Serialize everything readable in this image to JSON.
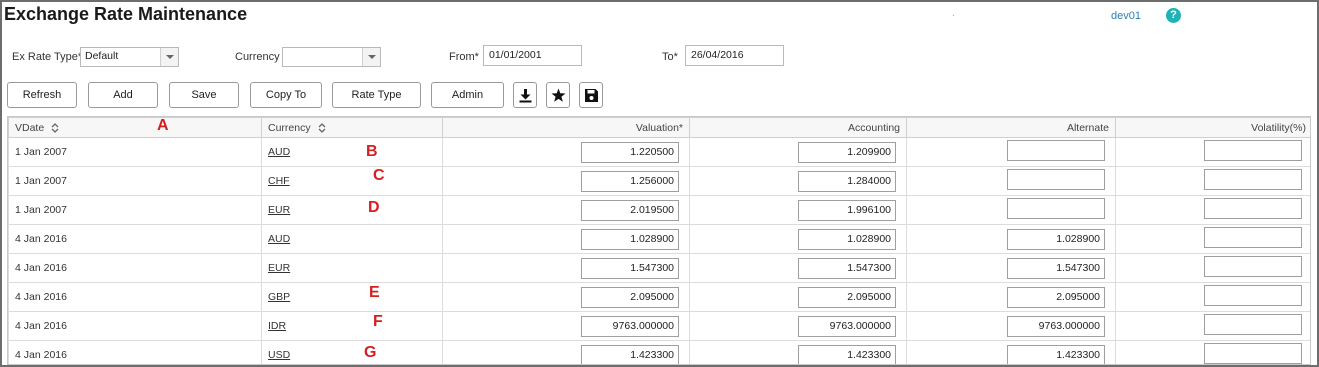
{
  "header": {
    "title": "Exchange Rate Maintenance",
    "separator": ".",
    "user": "dev01",
    "help_glyph": "?"
  },
  "filters": {
    "ex_rate_type_label": "Ex Rate Type*",
    "ex_rate_type_value": "Default",
    "currency_label": "Currency",
    "currency_value": "",
    "from_label": "From*",
    "from_value": "01/01/2001",
    "to_label": "To*",
    "to_value": "26/04/2016"
  },
  "toolbar": {
    "refresh": "Refresh",
    "add": "Add",
    "save": "Save",
    "copy_to": "Copy To",
    "rate_type": "Rate Type",
    "admin": "Admin",
    "icons": [
      "download-icon",
      "star-icon",
      "floppy-disk-icon"
    ]
  },
  "table": {
    "columns": [
      "VDate",
      "Currency",
      "Valuation*",
      "Accounting",
      "Alternate",
      "Volatility(%)"
    ],
    "rows": [
      {
        "vdate": "1 Jan 2007",
        "currency": "AUD",
        "valuation": "1.220500",
        "accounting": "1.209900",
        "alternate": "",
        "volatility": ""
      },
      {
        "vdate": "1 Jan 2007",
        "currency": "CHF",
        "valuation": "1.256000",
        "accounting": "1.284000",
        "alternate": "",
        "volatility": ""
      },
      {
        "vdate": "1 Jan 2007",
        "currency": "EUR",
        "valuation": "2.019500",
        "accounting": "1.996100",
        "alternate": "",
        "volatility": ""
      },
      {
        "vdate": "4 Jan 2016",
        "currency": "AUD",
        "valuation": "1.028900",
        "accounting": "1.028900",
        "alternate": "1.028900",
        "volatility": ""
      },
      {
        "vdate": "4 Jan 2016",
        "currency": "EUR",
        "valuation": "1.547300",
        "accounting": "1.547300",
        "alternate": "1.547300",
        "volatility": ""
      },
      {
        "vdate": "4 Jan 2016",
        "currency": "GBP",
        "valuation": "2.095000",
        "accounting": "2.095000",
        "alternate": "2.095000",
        "volatility": ""
      },
      {
        "vdate": "4 Jan 2016",
        "currency": "IDR",
        "valuation": "9763.000000",
        "accounting": "9763.000000",
        "alternate": "9763.000000",
        "volatility": ""
      },
      {
        "vdate": "4 Jan 2016",
        "currency": "USD",
        "valuation": "1.423300",
        "accounting": "1.423300",
        "alternate": "1.423300",
        "volatility": ""
      }
    ]
  },
  "markers": [
    "A",
    "B",
    "C",
    "D",
    "E",
    "F",
    "G"
  ],
  "colors": {
    "accent": "#2a7fb8",
    "help": "#1fb3b7",
    "marker": "#d42020"
  }
}
